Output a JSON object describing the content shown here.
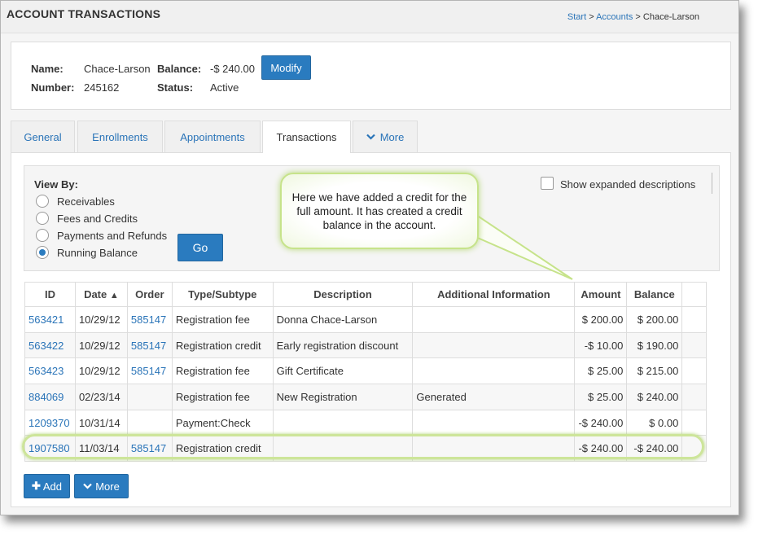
{
  "header": {
    "title": "ACCOUNT TRANSACTIONS",
    "breadcrumb": {
      "start": "Start",
      "sep1": ">",
      "accounts": "Accounts",
      "sep2": ">",
      "current": "Chace-Larson"
    }
  },
  "summary": {
    "name_label": "Name:",
    "name_value": "Chace-Larson",
    "balance_label": "Balance:",
    "balance_value": "-$ 240.00",
    "modify_label": "Modify",
    "number_label": "Number:",
    "number_value": "245162",
    "status_label": "Status:",
    "status_value": "Active"
  },
  "tabs": [
    {
      "label": "General"
    },
    {
      "label": "Enrollments"
    },
    {
      "label": "Appointments"
    },
    {
      "label": "Transactions",
      "active": true
    },
    {
      "label": "More",
      "icon": "chevron-down-icon"
    }
  ],
  "view_by": {
    "label": "View By:",
    "options": [
      {
        "label": "Receivables",
        "checked": false
      },
      {
        "label": "Fees and Credits",
        "checked": false
      },
      {
        "label": "Payments and Refunds",
        "checked": false
      },
      {
        "label": "Running Balance",
        "checked": true
      }
    ],
    "go_label": "Go",
    "expanded_label": "Show expanded descriptions",
    "expanded_checked": false
  },
  "table": {
    "columns": [
      "ID",
      "Date",
      "Order",
      "Type/Subtype",
      "Description",
      "Additional Information",
      "Amount",
      "Balance"
    ],
    "sort_indicator": "▲",
    "rows": [
      [
        "563421",
        "10/29/12",
        "585147",
        "Registration fee",
        "Donna Chace-Larson",
        "",
        "$ 200.00",
        "$ 200.00"
      ],
      [
        "563422",
        "10/29/12",
        "585147",
        "Registration credit",
        "Early registration discount",
        "",
        "-$ 10.00",
        "$ 190.00"
      ],
      [
        "563423",
        "10/29/12",
        "585147",
        "Registration fee",
        "Gift Certificate",
        "",
        "$ 25.00",
        "$ 215.00"
      ],
      [
        "884069",
        "02/23/14",
        "",
        "Registration fee",
        "New Registration",
        "Generated",
        "$ 25.00",
        "$ 240.00"
      ],
      [
        "1209370",
        "10/31/14",
        "",
        "Payment:Check",
        "",
        "",
        "-$ 240.00",
        "$ 0.00"
      ],
      [
        "1907580",
        "11/03/14",
        "585147",
        "Registration credit",
        "",
        "",
        "-$ 240.00",
        "-$ 240.00"
      ]
    ]
  },
  "actions": {
    "add_label": "Add",
    "more_label": "More"
  },
  "callout": {
    "text": "Here we have added a credit for the full amount. It has created a credit balance in the account."
  },
  "colors": {
    "accent": "#2a7bbf",
    "link": "#2a74b8",
    "highlight": "#c6e38a"
  }
}
